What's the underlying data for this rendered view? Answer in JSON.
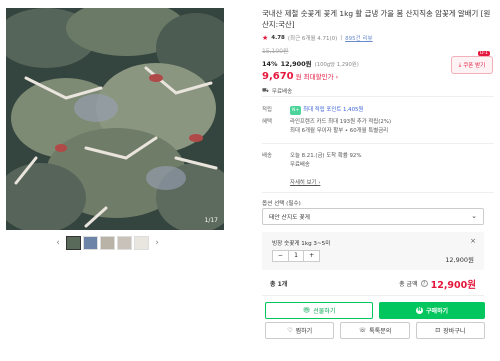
{
  "product": {
    "title": "국내산 제철 숫꽃게 꽃게 1kg 활 급냉 가을 봄 산지직송 암꽃게 알배기 [원산지:국산]",
    "rating": "4.78",
    "rating_detail": "(최근 6개월 4.71(0)",
    "review_link": "895건 리뷰",
    "original_price": "15,100원",
    "sale_percent": "14%",
    "sale_price": "12,900원",
    "unit_price": "(100g당 1,290원)",
    "best_price": "9,670",
    "best_label": "원 최대할인가 ›",
    "shipping_note": "무료배송"
  },
  "coupon": {
    "label": "쿠폰 받기",
    "badge": "D-1"
  },
  "info": {
    "point_label": "적립",
    "point_tag": "N+",
    "point_text": "최대 적립 포인트 1,405원",
    "benefit_label": "혜택",
    "benefit_line1": "라인프렌즈 카드 최대 193원 추가 적립(2%)",
    "benefit_line2": "최대 6개월 무이자 할부 • 60개월 특별금리",
    "delivery_label": "배송",
    "delivery_line1": "오늘 8.21.(금) 도착 확률 92%",
    "delivery_line2": "무료배송",
    "delivery_line3": "",
    "delivery_more": "자세히 보기 ›"
  },
  "option": {
    "label": "옵션 선택 (필수)",
    "selected_value": "태안 산지도 꽃게"
  },
  "selection": {
    "name": "빙장 숫꽃게 1kg 3~5미",
    "quantity": "1",
    "minus": "−",
    "plus": "+",
    "price": "12,900원",
    "close": "×"
  },
  "total": {
    "count": "총 1개",
    "label": "총 금액",
    "price": "12,900원",
    "help": "?"
  },
  "buttons": {
    "gift": "선물하기",
    "buy": "구매하기",
    "wish": "찜하기",
    "inquiry": "톡톡문의",
    "cart": "장바구니"
  },
  "gallery": {
    "counter": "1/17",
    "prev": "‹",
    "next": "›"
  }
}
